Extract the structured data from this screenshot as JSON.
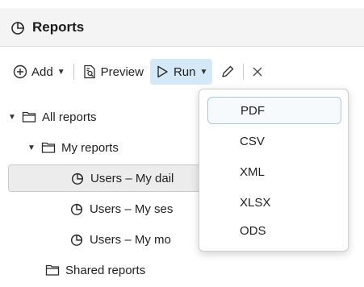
{
  "header": {
    "title": "Reports",
    "icon": "chart-pie-icon"
  },
  "toolbar": {
    "add_label": "Add",
    "preview_label": "Preview",
    "run_label": "Run",
    "accent_color": "#d5e8f7"
  },
  "tree": {
    "all_reports": "All reports",
    "my_reports": "My reports",
    "items": [
      "Users – My dail",
      "Users – My ses",
      "Users – My mo"
    ],
    "shared_reports": "Shared reports"
  },
  "run_menu": {
    "options": [
      "PDF",
      "CSV",
      "XML",
      "XLSX",
      "ODS"
    ],
    "highlighted": "PDF"
  }
}
